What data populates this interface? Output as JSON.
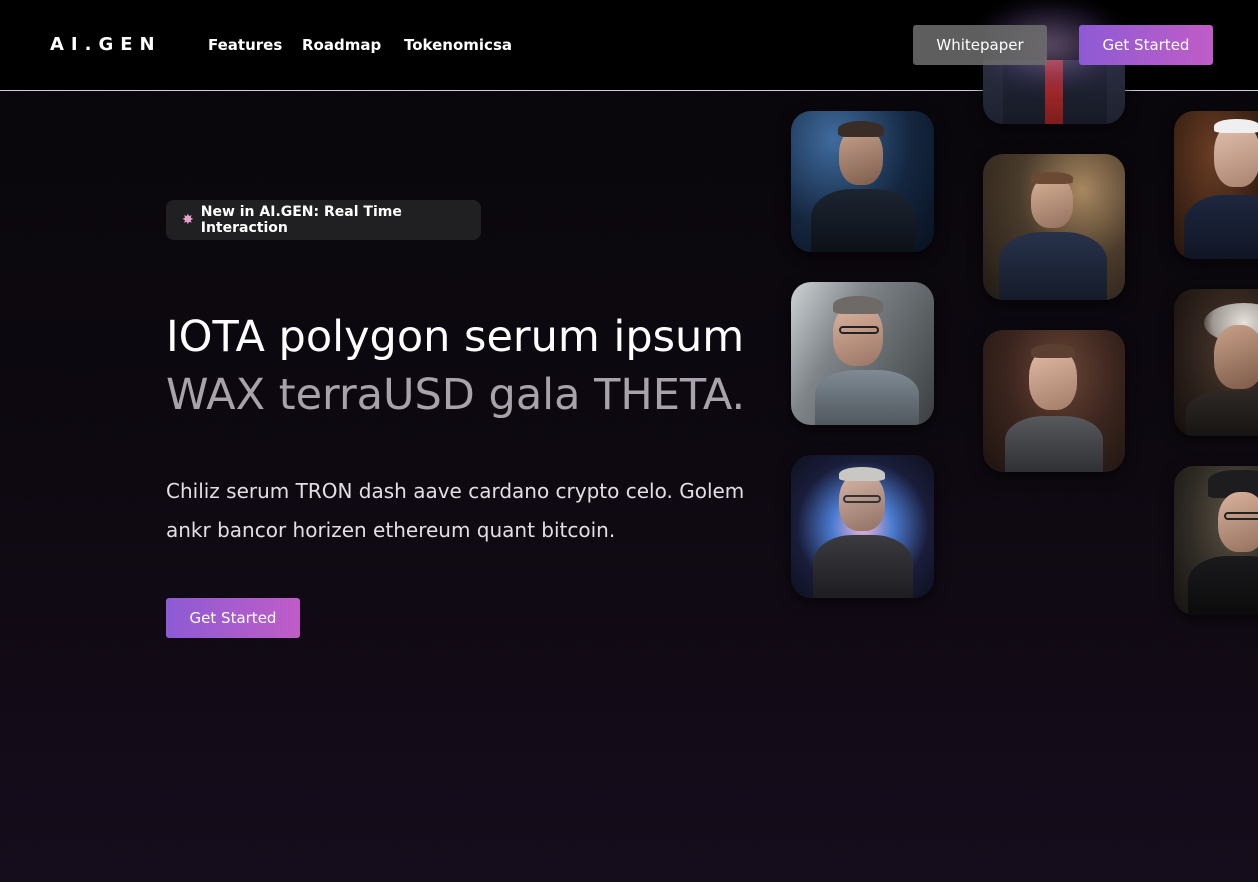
{
  "nav": {
    "logo": "AI.GEN",
    "links": [
      "Features",
      "Roadmap",
      "Tokenomicsa"
    ],
    "whitepaper_label": "Whitepaper",
    "get_started_label": "Get Started"
  },
  "hero": {
    "badge_icon": "party-popper-icon",
    "badge_text": "New in AI.GEN: Real Time Interaction",
    "headline_line1": "IOTA polygon serum ipsum",
    "headline_line2": "WAX terraUSD gala THETA.",
    "subtext": "Chiliz serum TRON dash aave cardano crypto celo. Golem ankr bancor horizen ethereum quant bitcoin.",
    "cta_label": "Get Started"
  },
  "colors": {
    "accent_start": "#8d5bd4",
    "accent_end": "#c05cc7",
    "background": "#0e0911",
    "badge_bg": "#202023",
    "headline_secondary": "#a7a2ab"
  },
  "portraits": [
    "portrait-1",
    "portrait-2",
    "portrait-3",
    "portrait-4",
    "portrait-5",
    "portrait-6",
    "portrait-7",
    "portrait-8",
    "portrait-9"
  ]
}
